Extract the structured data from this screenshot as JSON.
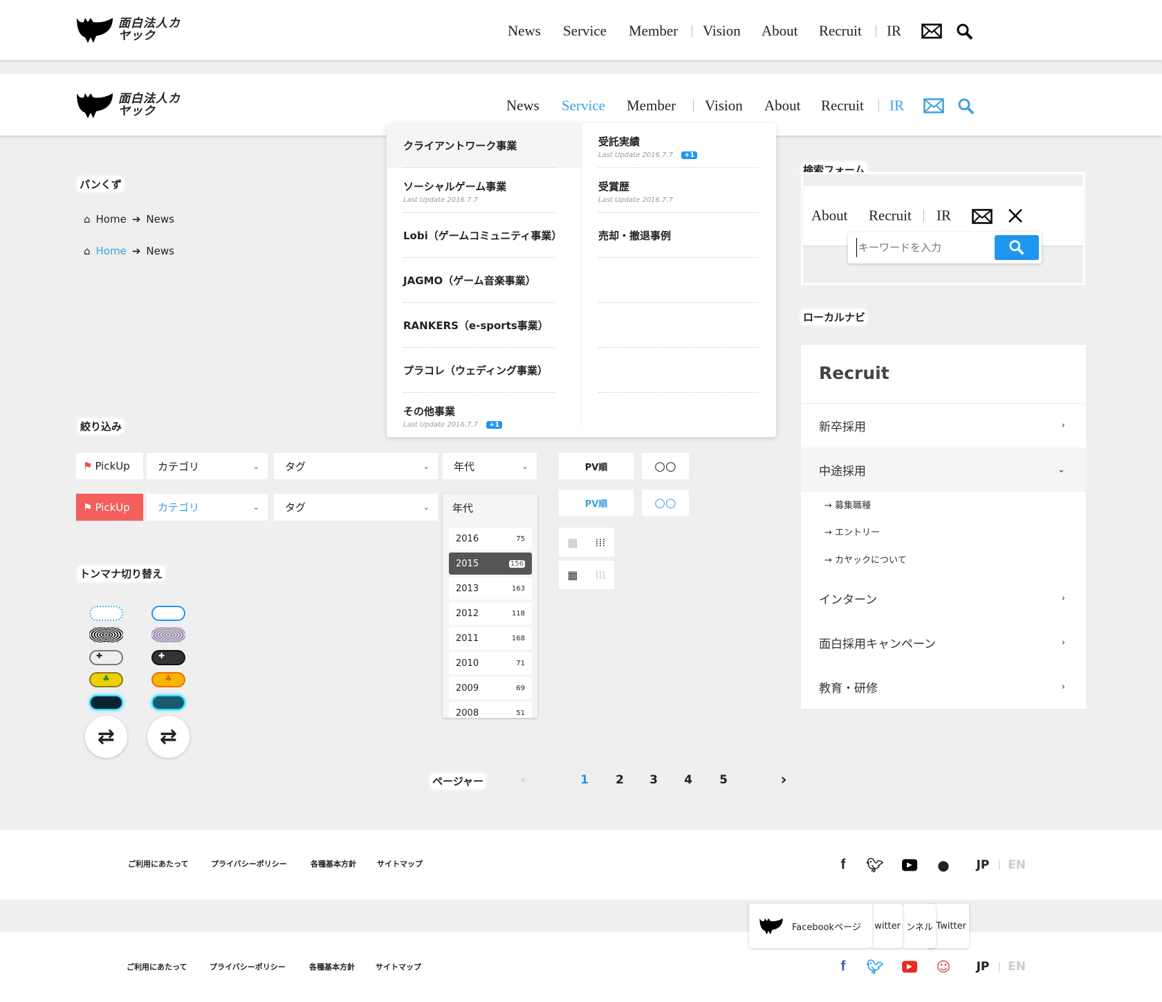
{
  "logo": {
    "text": "面白法人カヤック"
  },
  "nav": {
    "items": [
      "News",
      "Service",
      "Member",
      "Vision",
      "About",
      "Recruit",
      "IR"
    ],
    "active": "Service",
    "accent": "#3d9fe0"
  },
  "dropdown": {
    "left": [
      {
        "title": "クライアントワーク事業"
      },
      {
        "title": "ソーシャルゲーム事業",
        "sub": "Last Update 2016.7.7"
      },
      {
        "title": "Lobi（ゲームコミュニティ事業）"
      },
      {
        "title": "JAGMO（ゲーム音楽事業）"
      },
      {
        "title": "RANKERS（e-sports事業）"
      },
      {
        "title": "プラコレ（ウェディング事業）"
      },
      {
        "title": "その他事業",
        "sub": "Last Update 2016.7.7",
        "badge": "+1"
      }
    ],
    "right": [
      {
        "title": "受託実績",
        "sub": "Last Update 2016.7.7",
        "badge": "+1"
      },
      {
        "title": "受賞歴",
        "sub": "Last Update 2016.7.7"
      },
      {
        "title": "売却・撤退事例"
      }
    ]
  },
  "breadcrumb": {
    "label": "パンくず",
    "home": "Home",
    "current": "News"
  },
  "filter": {
    "label": "絞り込み",
    "pickup": "PickUp",
    "category": "カテゴリ",
    "tag": "タグ",
    "era": "年代",
    "pv": "PV順",
    "pickup_active_color": "#f25f5c"
  },
  "years": [
    {
      "y": "2016",
      "c": "75"
    },
    {
      "y": "2015",
      "c": "156",
      "selected": true
    },
    {
      "y": "2013",
      "c": "163"
    },
    {
      "y": "2012",
      "c": "118"
    },
    {
      "y": "2011",
      "c": "168"
    },
    {
      "y": "2010",
      "c": "71"
    },
    {
      "y": "2009",
      "c": "69"
    },
    {
      "y": "2008",
      "c": "51"
    }
  ],
  "theme": {
    "label": "トンマナ切り替え"
  },
  "search_form": {
    "label": "検索フォーム",
    "nav": [
      "About",
      "Recruit",
      "IR"
    ],
    "placeholder": "キーワードを入力"
  },
  "local_nav": {
    "label": "ローカルナビ",
    "title": "Recruit",
    "items": [
      "新卒採用",
      "中途採用",
      "インターン",
      "面白採用キャンペーン",
      "教育・研修"
    ],
    "sub_items": [
      "募集職種",
      "エントリー",
      "カヤックについて"
    ]
  },
  "pager": {
    "label": "ページャー",
    "pages": [
      "1",
      "2",
      "3",
      "4",
      "5"
    ],
    "current": "1"
  },
  "footer": {
    "links": [
      "ご利用にあたって",
      "プライバシーポリシー",
      "各種基本方針",
      "サイトマップ"
    ],
    "lang": [
      "JP",
      "EN"
    ],
    "tooltips": [
      "Facebookページ",
      "witter",
      "ンネル",
      "Twitter"
    ]
  }
}
